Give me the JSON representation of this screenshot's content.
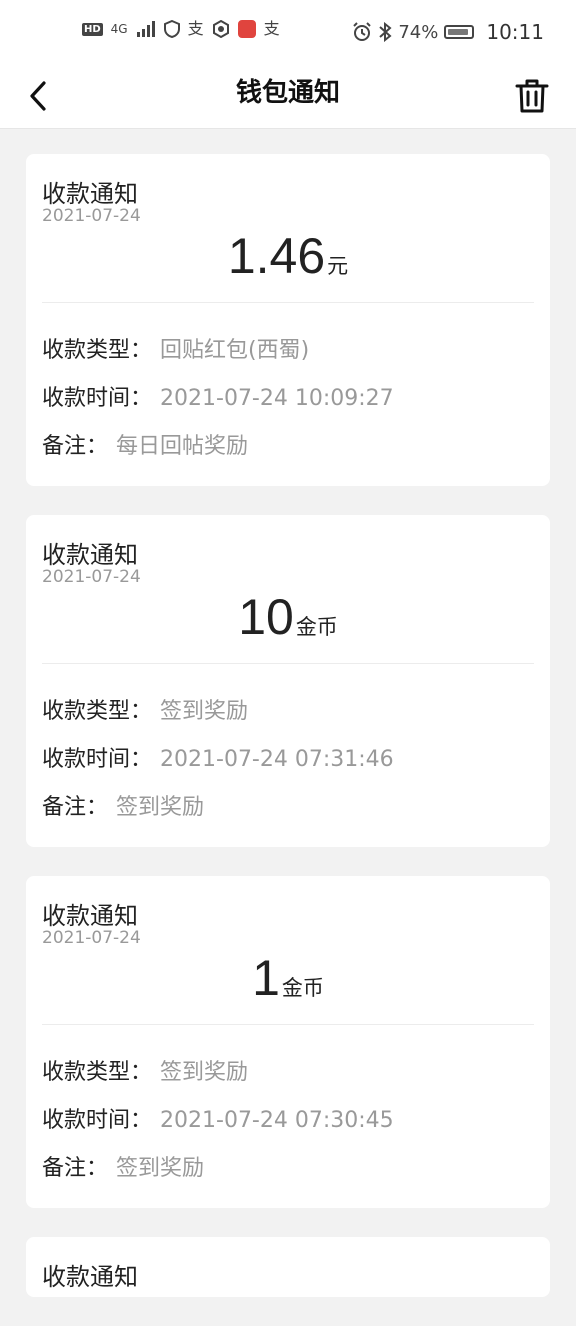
{
  "status_bar": {
    "hd_badge": "HD",
    "network": "4G",
    "battery": "74%",
    "time": "10:11",
    "icons": [
      "signal-icon",
      "shield-icon",
      "alipay-icon",
      "hexagon-app-icon",
      "red-app-icon",
      "alipay-icon",
      "alarm-icon",
      "bluetooth-icon",
      "battery-icon"
    ]
  },
  "nav": {
    "title": "钱包通知",
    "back_icon": "chevron-left-icon",
    "delete_icon": "trash-icon"
  },
  "notifications": [
    {
      "title": "收款通知",
      "date": "2021-07-24",
      "amount": "1.46",
      "unit": "元",
      "type_label": "收款类型：",
      "type_value": "回贴红包(西蜀)",
      "time_label": "收款时间：",
      "time_value": "2021-07-24 10:09:27",
      "note_label": "备注：",
      "note_value": "每日回帖奖励"
    },
    {
      "title": "收款通知",
      "date": "2021-07-24",
      "amount": "10",
      "unit": "金币",
      "type_label": "收款类型：",
      "type_value": "签到奖励",
      "time_label": "收款时间：",
      "time_value": "2021-07-24 07:31:46",
      "note_label": "备注：",
      "note_value": "签到奖励"
    },
    {
      "title": "收款通知",
      "date": "2021-07-24",
      "amount": "1",
      "unit": "金币",
      "type_label": "收款类型：",
      "type_value": "签到奖励",
      "time_label": "收款时间：",
      "time_value": "2021-07-24 07:30:45",
      "note_label": "备注：",
      "note_value": "签到奖励"
    },
    {
      "title": "收款通知"
    }
  ]
}
